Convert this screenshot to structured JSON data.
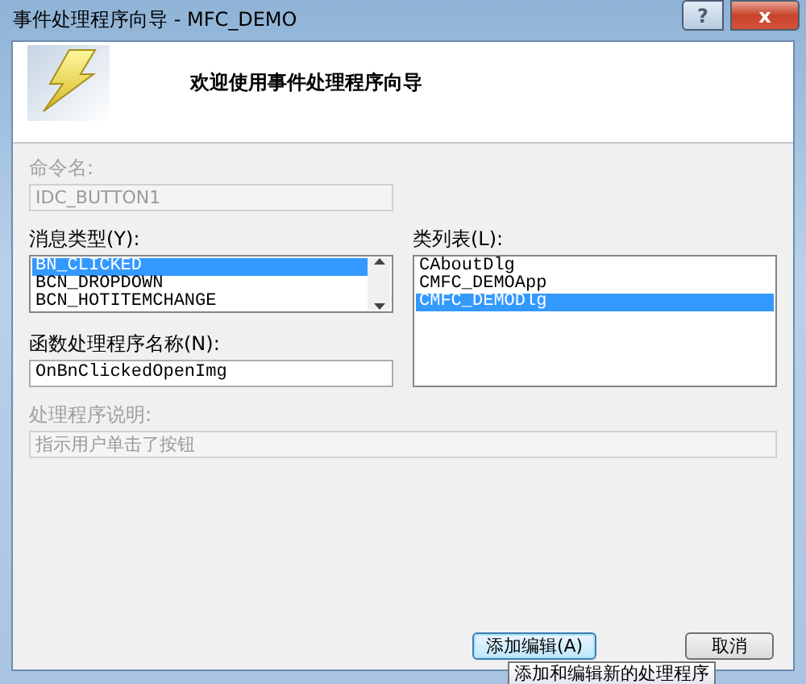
{
  "window": {
    "title": "事件处理程序向导 - MFC_DEMO",
    "help_button": "?",
    "close_button": "x"
  },
  "header": {
    "title": "欢迎使用事件处理程序向导"
  },
  "command_name": {
    "label": "命令名:",
    "value": "IDC_BUTTON1",
    "disabled": true
  },
  "message_type": {
    "label": "消息类型(Y):",
    "items": [
      {
        "text": "BN_CLICKED",
        "selected": true
      },
      {
        "text": "BCN_DROPDOWN",
        "selected": false
      },
      {
        "text": "BCN_HOTITEMCHANGE",
        "selected": false
      }
    ]
  },
  "class_list": {
    "label": "类列表(L):",
    "items": [
      {
        "text": "CAboutDlg",
        "selected": false
      },
      {
        "text": "CMFC_DEMOApp",
        "selected": false
      },
      {
        "text": "CMFC_DEMODlg",
        "selected": true
      }
    ]
  },
  "handler_name": {
    "label": "函数处理程序名称(N):",
    "value": "OnBnClickedOpenImg",
    "disabled": false
  },
  "description": {
    "label": "处理程序说明:",
    "value": "指示用户单击了按钮",
    "disabled": true
  },
  "buttons": [
    {
      "label": "添加编辑(A)",
      "kind": "default"
    },
    {
      "label": "取消",
      "kind": "normal"
    }
  ],
  "tooltip": {
    "text": "添加和编辑新的处理程序"
  }
}
